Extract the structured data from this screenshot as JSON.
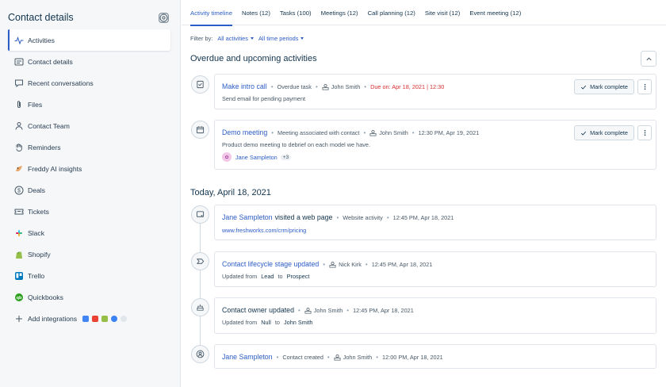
{
  "sidebar": {
    "title": "Contact details",
    "items": [
      {
        "label": "Activities",
        "icon": "activity-pulse-icon"
      },
      {
        "label": "Contact details",
        "icon": "contact-card-icon"
      },
      {
        "label": "Recent conversations",
        "icon": "chat-bubble-icon"
      },
      {
        "label": "Files",
        "icon": "paperclip-icon"
      },
      {
        "label": "Contact Team",
        "icon": "team-icon"
      },
      {
        "label": "Reminders",
        "icon": "reminder-hand-icon"
      },
      {
        "label": "Freddy AI insights",
        "icon": "freddy-icon"
      },
      {
        "label": "Deals",
        "icon": "dollar-icon"
      },
      {
        "label": "Tickets",
        "icon": "ticket-icon"
      },
      {
        "label": "Slack",
        "icon": "slack-icon"
      },
      {
        "label": "Shopify",
        "icon": "shopify-icon"
      },
      {
        "label": "Trello",
        "icon": "trello-icon"
      },
      {
        "label": "Quickbooks",
        "icon": "quickbooks-icon"
      },
      {
        "label": "Add integrations",
        "icon": "plus-icon"
      }
    ]
  },
  "tabs": [
    {
      "label": "Activity timeline",
      "active": true
    },
    {
      "label": "Notes (12)"
    },
    {
      "label": "Tasks (100)"
    },
    {
      "label": "Meetings (12)"
    },
    {
      "label": "Call planning (12)"
    },
    {
      "label": "Site visit (12)"
    },
    {
      "label": "Event meeting (12)"
    }
  ],
  "filter": {
    "label": "Filter by:",
    "activities": "All activities",
    "periods": "All time periods"
  },
  "sections": {
    "overdue_title": "Overdue and upcoming activities",
    "today_title": "Today, April 18, 2021"
  },
  "activities": {
    "task": {
      "title": "Make intro call",
      "type": "Overdue task",
      "owner": "John Smith",
      "due": "Due on: Apr 18, 2021 | 12:30",
      "description": "Send email for pending payment",
      "action": "Mark complete"
    },
    "meeting": {
      "title": "Demo meeting",
      "type": "Meeting associated with contact",
      "owner": "John Smith",
      "time": "12:30 PM, Apr 19, 2021",
      "description": "Product demo meeting to debrief on each model we have.",
      "attendee": "Jane Sampleton",
      "attendee_more": "+3",
      "action": "Mark complete"
    },
    "web_visit": {
      "name": "Jane Sampleton",
      "text": "visited a web page",
      "type": "Website activity",
      "time": "12:45 PM, Apr 18, 2021",
      "url": "www.freshworks.com/crm/pricing"
    },
    "lifecycle": {
      "title": "Contact lifecycle stage updated",
      "owner": "Nick Kirk",
      "time": "12:45 PM, Apr 18, 2021",
      "prefix": "Updated from",
      "from": "Lead",
      "middle": "to",
      "to": "Prospect"
    },
    "owner_update": {
      "title": "Contact owner updated",
      "owner": "John Smith",
      "time": "12:45 PM, Apr 18, 2021",
      "prefix": "Updated from",
      "from": "Null",
      "middle": "to",
      "to": "John Smith"
    },
    "created": {
      "name": "Jane Sampleton",
      "type": "Contact created",
      "owner": "John Smith",
      "time": "12:00 PM, Apr 18, 2021"
    }
  },
  "colors": {
    "accent": "#2c5cc5",
    "due": "#d72d30",
    "text": "#12344d",
    "sidebar_bg": "#f5f7f9"
  }
}
